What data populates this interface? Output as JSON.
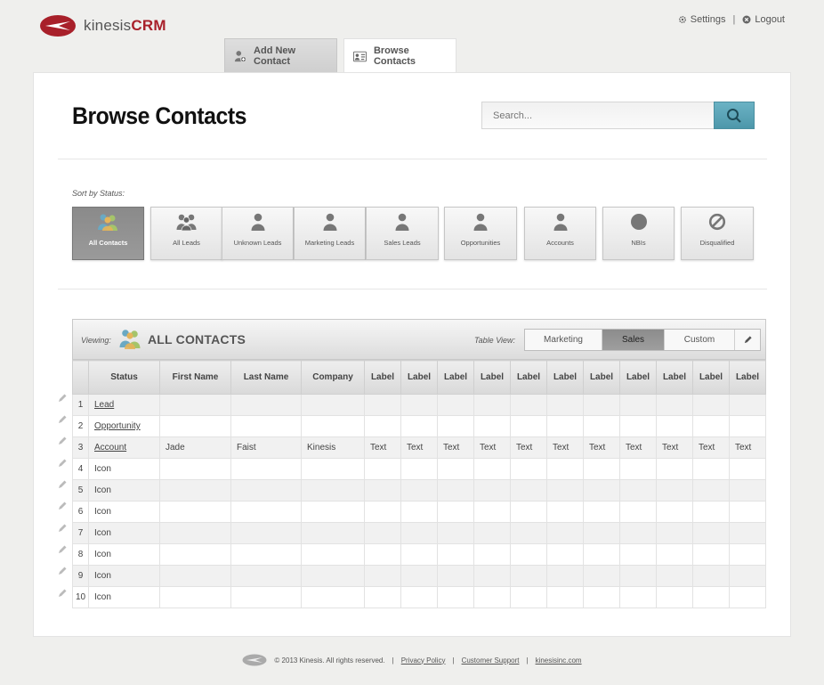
{
  "app": {
    "brand_name": "kinesis",
    "brand_suffix": "CRM",
    "brand_color": "#a8202a"
  },
  "account": {
    "settings_label": "Settings",
    "separator": "|",
    "logout_label": "Logout"
  },
  "tabs": [
    {
      "label": "Add New Contact",
      "active": false
    },
    {
      "label": "Browse Contacts",
      "active": true
    }
  ],
  "page": {
    "title": "Browse Contacts"
  },
  "search": {
    "placeholder": "Search...",
    "accent": "#5aa3b6"
  },
  "sort": {
    "label": "Sort by Status:",
    "buttons": [
      {
        "label": "All Contacts",
        "icon": "group-color-icon",
        "active": true
      },
      {
        "label": "All Leads",
        "icon": "group-icon"
      },
      {
        "label": "Unknown Leads",
        "icon": "person-icon"
      },
      {
        "label": "Marketing Leads",
        "icon": "person-icon"
      },
      {
        "label": "Sales Leads",
        "icon": "person-icon"
      },
      {
        "label": "Opportunities",
        "icon": "person-icon"
      },
      {
        "label": "Accounts",
        "icon": "person-icon"
      },
      {
        "label": "NBIs",
        "icon": "circle-icon"
      },
      {
        "label": "Disqualified",
        "icon": "prohibited-icon"
      }
    ]
  },
  "grid": {
    "viewing_label": "Viewing:",
    "viewing_title": "ALL CONTACTS",
    "tableview_label": "Table View:",
    "views": [
      {
        "label": "Marketing",
        "active": false
      },
      {
        "label": "Sales",
        "active": true
      },
      {
        "label": "Custom",
        "active": false
      }
    ],
    "columns": [
      "",
      "Status",
      "First Name",
      "Last Name",
      "Company",
      "Label",
      "Label",
      "Label",
      "Label",
      "Label",
      "Label",
      "Label",
      "Label",
      "Label",
      "Label",
      "Label"
    ],
    "rows": [
      {
        "num": "1",
        "status": "Lead",
        "link": true,
        "cells": [
          "",
          "",
          "",
          "",
          "",
          "",
          "",
          "",
          "",
          "",
          "",
          "",
          "",
          ""
        ]
      },
      {
        "num": "2",
        "status": "Opportunity",
        "link": true,
        "cells": [
          "",
          "",
          "",
          "",
          "",
          "",
          "",
          "",
          "",
          "",
          "",
          "",
          "",
          ""
        ]
      },
      {
        "num": "3",
        "status": "Account",
        "link": true,
        "cells": [
          "Jade",
          "Faist",
          "Kinesis",
          "Text",
          "Text",
          "Text",
          "Text",
          "Text",
          "Text",
          "Text",
          "Text",
          "Text",
          "Text",
          "Text"
        ]
      },
      {
        "num": "4",
        "status": "Icon",
        "link": false,
        "cells": [
          "",
          "",
          "",
          "",
          "",
          "",
          "",
          "",
          "",
          "",
          "",
          "",
          "",
          ""
        ]
      },
      {
        "num": "5",
        "status": "Icon",
        "link": false,
        "cells": [
          "",
          "",
          "",
          "",
          "",
          "",
          "",
          "",
          "",
          "",
          "",
          "",
          "",
          ""
        ]
      },
      {
        "num": "6",
        "status": "Icon",
        "link": false,
        "cells": [
          "",
          "",
          "",
          "",
          "",
          "",
          "",
          "",
          "",
          "",
          "",
          "",
          "",
          ""
        ]
      },
      {
        "num": "7",
        "status": "Icon",
        "link": false,
        "cells": [
          "",
          "",
          "",
          "",
          "",
          "",
          "",
          "",
          "",
          "",
          "",
          "",
          "",
          ""
        ]
      },
      {
        "num": "8",
        "status": "Icon",
        "link": false,
        "cells": [
          "",
          "",
          "",
          "",
          "",
          "",
          "",
          "",
          "",
          "",
          "",
          "",
          "",
          ""
        ]
      },
      {
        "num": "9",
        "status": "Icon",
        "link": false,
        "cells": [
          "",
          "",
          "",
          "",
          "",
          "",
          "",
          "",
          "",
          "",
          "",
          "",
          "",
          ""
        ]
      },
      {
        "num": "10",
        "status": "Icon",
        "link": false,
        "cells": [
          "",
          "",
          "",
          "",
          "",
          "",
          "",
          "",
          "",
          "",
          "",
          "",
          "",
          ""
        ]
      }
    ]
  },
  "footer": {
    "copyright": "© 2013 Kinesis. All rights reserved.",
    "sep": "|",
    "privacy": "Privacy Policy",
    "support": "Customer Support",
    "site": "kinesisinc.com"
  }
}
